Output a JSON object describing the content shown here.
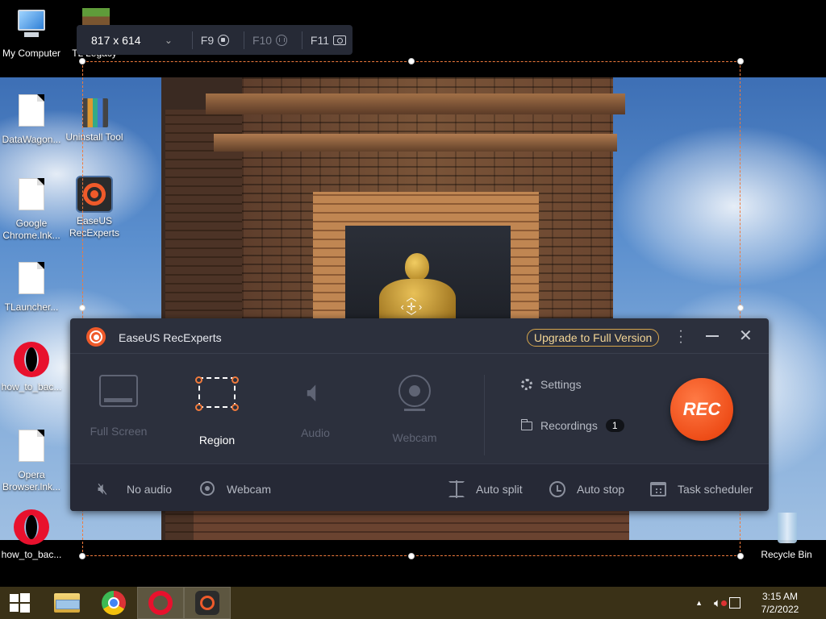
{
  "desktop": {
    "icons": [
      {
        "label": "My Computer"
      },
      {
        "label": "TL Legacy"
      },
      {
        "label": "DataWagon..."
      },
      {
        "label": "Uninstall Tool"
      },
      {
        "label": "Google Chrome.lnk..."
      },
      {
        "label": "EaseUS RecExperts"
      },
      {
        "label": "TLauncher..."
      },
      {
        "label": "how_to_bac..."
      },
      {
        "label": "Opera Browser.lnk..."
      },
      {
        "label": "how_to_bac..."
      },
      {
        "label": "Recycle Bin"
      }
    ]
  },
  "size_bar": {
    "dimensions": "817 x 614",
    "hotkeys": [
      {
        "key": "F9",
        "icon": "record-icon"
      },
      {
        "key": "F10",
        "icon": "pause-icon"
      },
      {
        "key": "F11",
        "icon": "screenshot-icon"
      }
    ]
  },
  "recorder": {
    "title": "EaseUS RecExperts",
    "upgrade_label": "Upgrade to Full Version",
    "modes": [
      {
        "label": "Full Screen",
        "active": false
      },
      {
        "label": "Region",
        "active": true
      },
      {
        "label": "Audio",
        "active": false
      },
      {
        "label": "Webcam",
        "active": false
      }
    ],
    "settings_label": "Settings",
    "recordings_label": "Recordings",
    "recordings_count": "1",
    "rec_label": "REC",
    "footer": {
      "no_audio": "No audio",
      "webcam": "Webcam",
      "auto_split": "Auto split",
      "auto_stop": "Auto stop",
      "task_scheduler": "Task scheduler"
    }
  },
  "taskbar": {
    "time": "3:15 AM",
    "date": "7/2/2022"
  },
  "colors": {
    "accent": "#ef5a2a",
    "panel_bg": "#2c303d",
    "upgrade_border": "#d7a64b",
    "taskbar": "#3a3117"
  }
}
